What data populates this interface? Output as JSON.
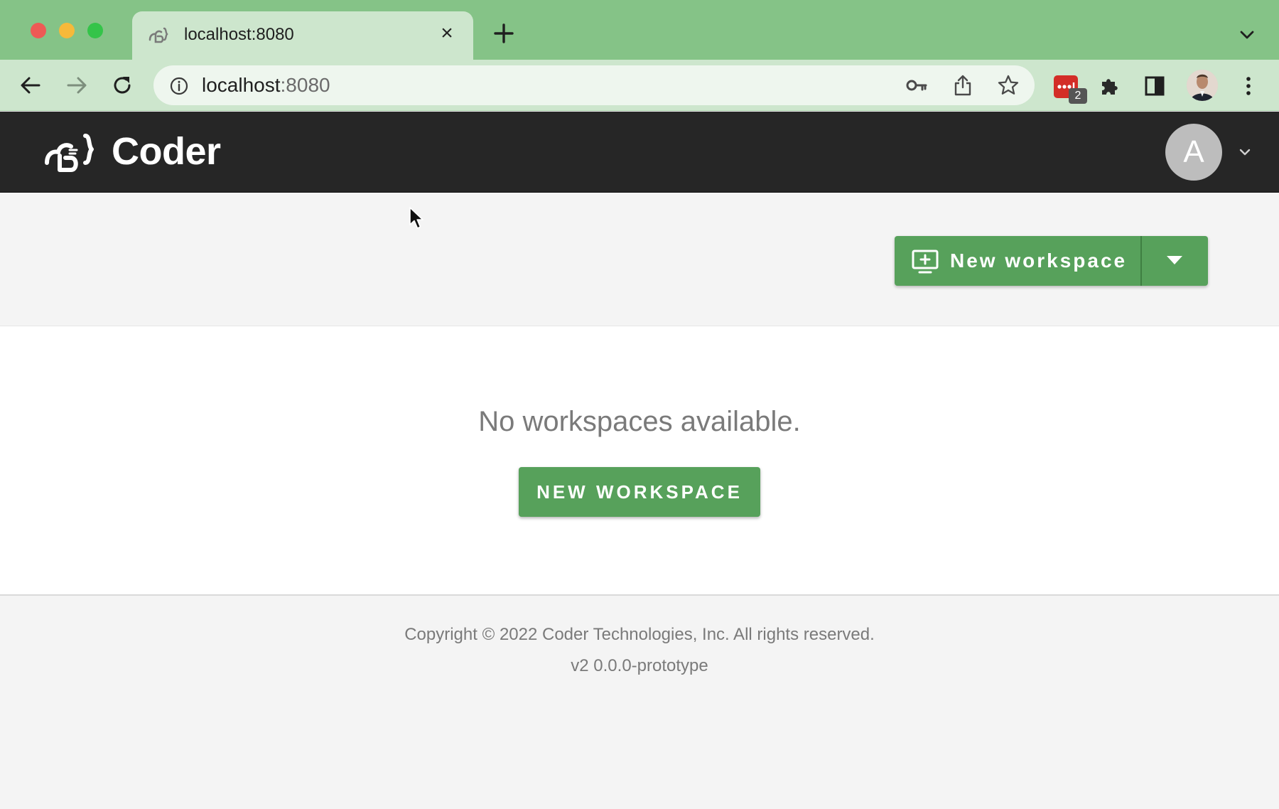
{
  "browser": {
    "tab": {
      "title": "localhost:8080"
    },
    "address": {
      "host": "localhost",
      "port": ":8080"
    },
    "extension_badge": "2"
  },
  "app": {
    "brand": "Coder",
    "user_initial": "A"
  },
  "actions": {
    "new_workspace_label": "New workspace"
  },
  "empty_state": {
    "message": "No workspaces available.",
    "cta_label": "NEW WORKSPACE"
  },
  "footer": {
    "copyright": "Copyright © 2022 Coder Technologies, Inc. All rights reserved.",
    "version": "v2 0.0.0-prototype"
  },
  "colors": {
    "chrome_titlebar": "#85c387",
    "chrome_toolbar": "#cde6cd",
    "header_bg": "#262626",
    "primary_green": "#57a15b",
    "page_bg": "#f4f4f4"
  }
}
